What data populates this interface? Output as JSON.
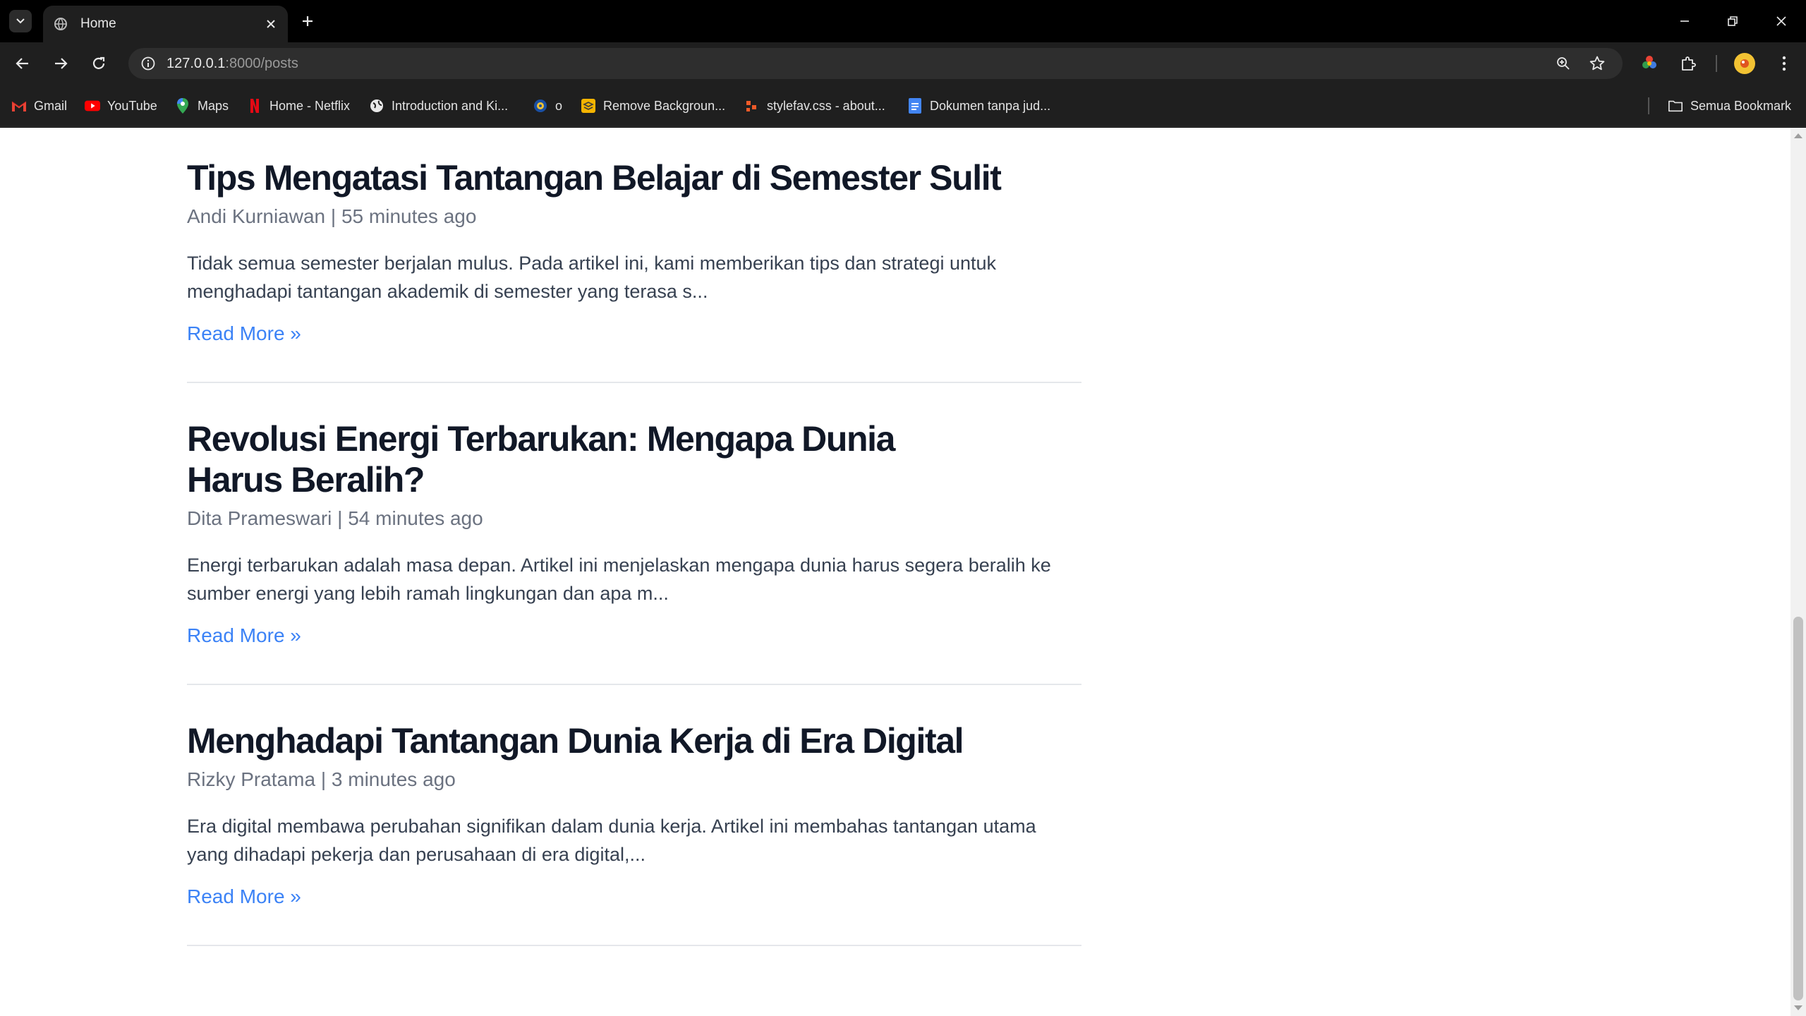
{
  "browser": {
    "tab_title": "Home",
    "url_host": "127.0.0.1",
    "url_rest": ":8000/posts",
    "bookmarks": [
      {
        "label": "Gmail",
        "icon": "gmail-icon"
      },
      {
        "label": "YouTube",
        "icon": "youtube-icon"
      },
      {
        "label": "Maps",
        "icon": "maps-icon"
      },
      {
        "label": "Home - Netflix",
        "icon": "netflix-icon"
      },
      {
        "label": "Introduction and Ki...",
        "icon": "globe-icon"
      },
      {
        "label": "o",
        "icon": "badge-icon"
      },
      {
        "label": "Remove Backgroun...",
        "icon": "removebg-icon"
      },
      {
        "label": "stylefav.css - about...",
        "icon": "code-icon"
      },
      {
        "label": "Dokumen tanpa jud...",
        "icon": "docs-icon"
      }
    ],
    "all_bookmarks": "Semua Bookmark"
  },
  "posts": [
    {
      "title": "Tips Mengatasi Tantangan Belajar di Semester Sulit",
      "author": "Andi Kurniawan",
      "time": "55 minutes ago",
      "excerpt": "Tidak semua semester berjalan mulus. Pada artikel ini, kami memberikan tips dan strategi untuk menghadapi tantangan akademik di semester yang terasa s...",
      "read_more": "Read More »"
    },
    {
      "title": "Revolusi Energi Terbarukan: Mengapa Dunia Harus Beralih?",
      "author": "Dita Prameswari",
      "time": "54 minutes ago",
      "excerpt": "Energi terbarukan adalah masa depan. Artikel ini menjelaskan mengapa dunia harus segera beralih ke sumber energi yang lebih ramah lingkungan dan apa m...",
      "read_more": "Read More »"
    },
    {
      "title": "Menghadapi Tantangan Dunia Kerja di Era Digital",
      "author": "Rizky Pratama",
      "time": "3 minutes ago",
      "excerpt": "Era digital membawa perubahan signifikan dalam dunia kerja. Artikel ini membahas tantangan utama yang dihadapi pekerja dan perusahaan di era digital,...",
      "read_more": "Read More »"
    }
  ],
  "meta_separator": "|"
}
